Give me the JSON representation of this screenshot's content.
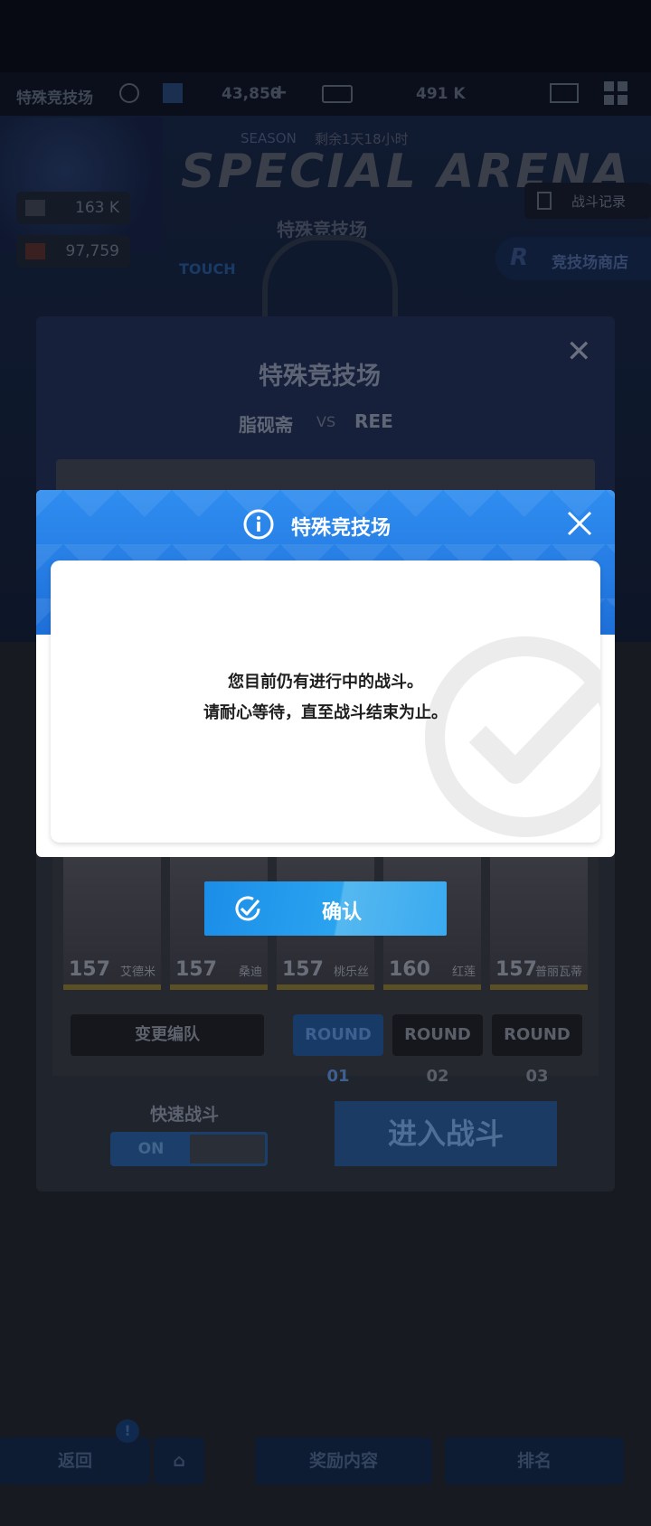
{
  "background": {
    "header": {
      "title": "特殊竞技场",
      "currency_1": "43,850",
      "currency_2": "491 K"
    },
    "season_label": "SEASON",
    "season_remaining": "剩余1天18小时",
    "arena_title_en": "SPECIAL ARENA",
    "arena_title_cn": "特殊竞技场",
    "touch_label": "TOUCH",
    "stat_1": "163 K",
    "stat_2": "97,759",
    "battle_record_button": "战斗记录",
    "arena_shop_button": "竞技场商店",
    "panel": {
      "title": "特殊竞技场",
      "player_left": "脂砚斋",
      "vs": "VS",
      "player_right": "REE",
      "team": [
        {
          "level": "157",
          "name": "艾德米"
        },
        {
          "level": "157",
          "name": "桑迪"
        },
        {
          "level": "157",
          "name": "桃乐丝"
        },
        {
          "level": "160",
          "name": "红莲"
        },
        {
          "level": "157",
          "name": "普丽瓦蒂"
        }
      ],
      "change_team_button": "变更编队",
      "rounds": [
        "ROUND 01",
        "ROUND 02",
        "ROUND 03"
      ],
      "quick_battle_label": "快速战斗",
      "quick_battle_state": "ON",
      "enter_battle_button": "进入战斗"
    },
    "bottom_nav": {
      "back_button": "返回",
      "reward_button": "奖励内容",
      "ranking_button": "排名"
    }
  },
  "dialog": {
    "title": "特殊竞技场",
    "message_line_1": "您目前仍有进行中的战斗。",
    "message_line_2": "请耐心等待，直至战斗结束为止。",
    "confirm_button": "确认"
  },
  "colors": {
    "dialog_header": "#1e6fd8",
    "confirm_button": "#1b8ee8"
  }
}
